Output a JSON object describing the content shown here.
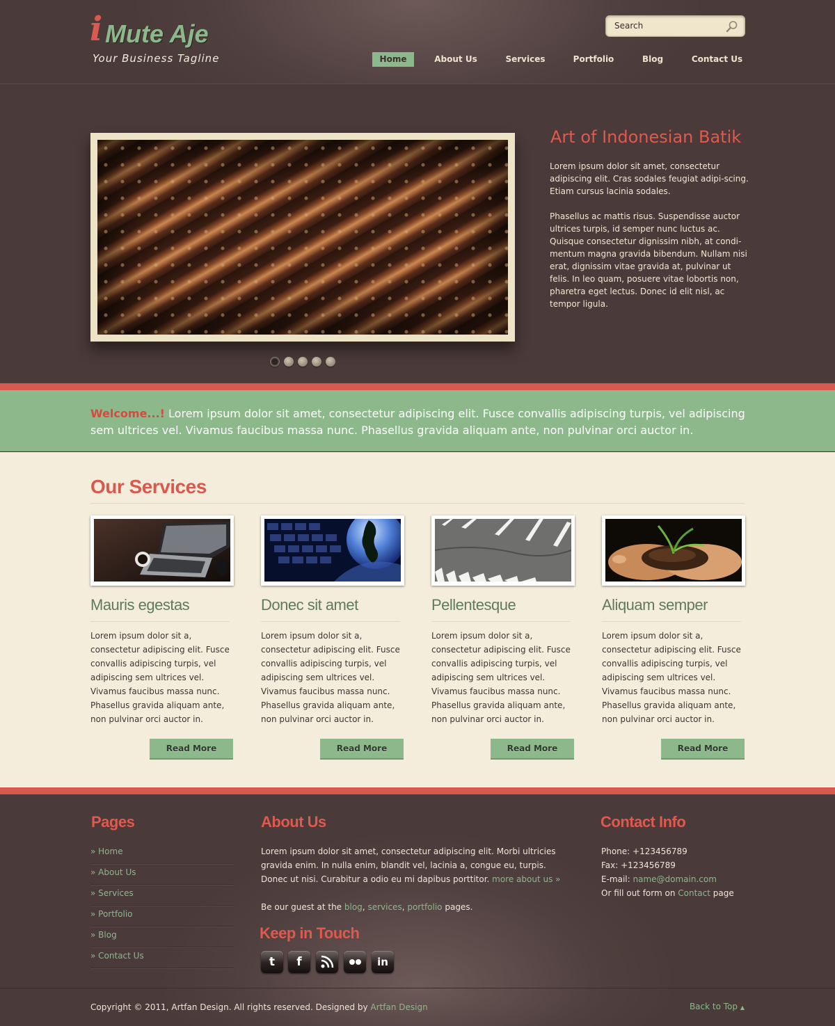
{
  "header": {
    "logo_i": "i",
    "logo_text": "Mute Aje",
    "tagline": "Your Business Tagline",
    "search_placeholder": "Search",
    "nav": [
      "Home",
      "About Us",
      "Services",
      "Portfolio",
      "Blog",
      "Contact Us"
    ],
    "active_nav": "Home"
  },
  "slider": {
    "title": "Art of Indonesian Batik",
    "paragraph1": "Lorem ipsum dolor sit amet, consectetur adipiscing elit. Cras sodales feugiat adipi-scing. Etiam cursus lacinia sodales.",
    "paragraph2": "Phasellus ac mattis risus. Suspendisse auctor ultrices turpis, id semper nunc luctus ac. Quisque consectetur dignissim nibh, at condi-mentum magna gravida bibendum. Nullam nisi erat, dignissim vitae gravida at, pulvinar ut felis. In leo quam, posuere vitae lobortis non, pharetra eget lectus. Donec id elit nisl, ac tempor ligula.",
    "slide_count": 5,
    "active_slide": 1
  },
  "welcome": {
    "lead": "Welcome...!",
    "text": " Lorem ipsum dolor sit amet, consectetur adipiscing elit. Fusce convallis adipiscing turpis, vel adipiscing sem ultrices vel. Vivamus faucibus massa nunc. Phasellus gravida aliquam ante, non pulvinar orci auctor in."
  },
  "services": {
    "title": "Our Services",
    "items": [
      {
        "title": "Mauris egestas",
        "image": "laptop-coffee",
        "text": "Lorem ipsum dolor sit a, consectetur adipiscing elit. Fusce convallis adipiscing turpis, vel adipiscing sem ultrices vel. Vivamus faucibus massa nunc. Phasellus gravida aliquam ante, non pulvinar orci auctor in.",
        "button": "Read More"
      },
      {
        "title": "Donec sit amet",
        "image": "keyboard-globe",
        "text": "Lorem ipsum dolor sit a, consectetur adipiscing elit. Fusce convallis adipiscing turpis, vel adipiscing sem ultrices vel. Vivamus faucibus massa nunc. Phasellus gravida aliquam ante, non pulvinar orci auctor in.",
        "button": "Read More"
      },
      {
        "title": "Pellentesque",
        "image": "road-markings",
        "text": "Lorem ipsum dolor sit a, consectetur adipiscing elit. Fusce convallis adipiscing turpis, vel adipiscing sem ultrices vel. Vivamus faucibus massa nunc. Phasellus gravida aliquam ante, non pulvinar orci auctor in.",
        "button": "Read More"
      },
      {
        "title": "Aliquam semper",
        "image": "hands-seedling",
        "text": "Lorem ipsum dolor sit a, consectetur adipiscing elit. Fusce convallis adipiscing turpis, vel adipiscing sem ultrices vel. Vivamus faucibus massa nunc. Phasellus gravida aliquam ante, non pulvinar orci auctor in.",
        "button": "Read More"
      }
    ]
  },
  "footer": {
    "pages_title": "Pages",
    "pages": [
      "Home",
      "About Us",
      "Services",
      "Portfolio",
      "Blog",
      "Contact Us"
    ],
    "about_title": "About Us",
    "about_text": "Lorem ipsum dolor sit amet, consectetur adipiscing elit. Morbi ultricies gravida enim. In nulla enim, blandit vel, lacinia a, congue eu, turpis. Donec ut nisi. Curabitur a odio eu mi dapibus porttitor. ",
    "about_more": "more about us »",
    "guest_prefix": "Be our guest at the ",
    "guest_blog": "blog",
    "guest_sep1": ", ",
    "guest_services": "services",
    "guest_sep2": ", ",
    "guest_portfolio": "portfolio",
    "guest_suffix": " pages.",
    "keep_title": "Keep in Touch",
    "social": [
      "twitter-icon",
      "facebook-icon",
      "rss-icon",
      "flickr-icon",
      "linkedin-icon"
    ],
    "contact_title": "Contact Info",
    "phone": "Phone: +123456789",
    "fax": "Fax: +123456789",
    "email_label": "E-mail: ",
    "email": "name@domain.com",
    "form_prefix": "Or fill out form on ",
    "form_link": "Contact",
    "form_suffix": " page"
  },
  "bottom": {
    "copyright": "Copyright © 2011, Artfan Design. All rights reserved. Designed by ",
    "designer": "Artfan Design",
    "back_to_top": "Back to Top"
  },
  "colors": {
    "accent_red": "#d95a50",
    "accent_green": "#8cb88b",
    "background": "#4a3a39",
    "content_bg": "#f5eddc"
  }
}
